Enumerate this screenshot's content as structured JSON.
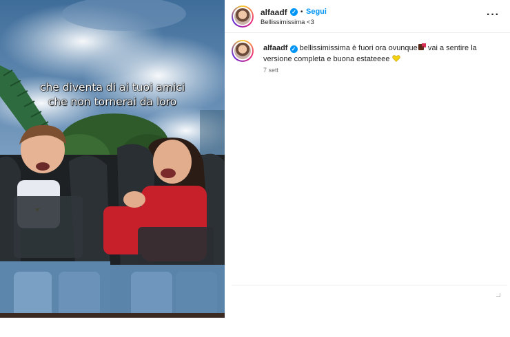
{
  "media": {
    "overlay_line1": "che diventa di ai tuoi amici",
    "overlay_line2": "che non tornerai da loro"
  },
  "header": {
    "username": "alfaadf",
    "separator": "•",
    "follow_label": "Segui",
    "subtitle": "Bellissimissima <3",
    "more_label": "•••"
  },
  "comment": {
    "username": "alfaadf",
    "text_part1": "bellissimissima è fuori ora ovunque",
    "text_part2": " vai a sentire la versione completa e buona estateeee ",
    "time": "7 sett"
  },
  "icons": {
    "verified": "verified-badge-icon",
    "more": "more-options-icon",
    "heart": "yellow-heart-icon",
    "chocolate": "chocolate-bar-icon"
  },
  "colors": {
    "accent": "#0095f6",
    "heart": "#f5d20f",
    "text": "#262626",
    "muted": "#737373"
  }
}
